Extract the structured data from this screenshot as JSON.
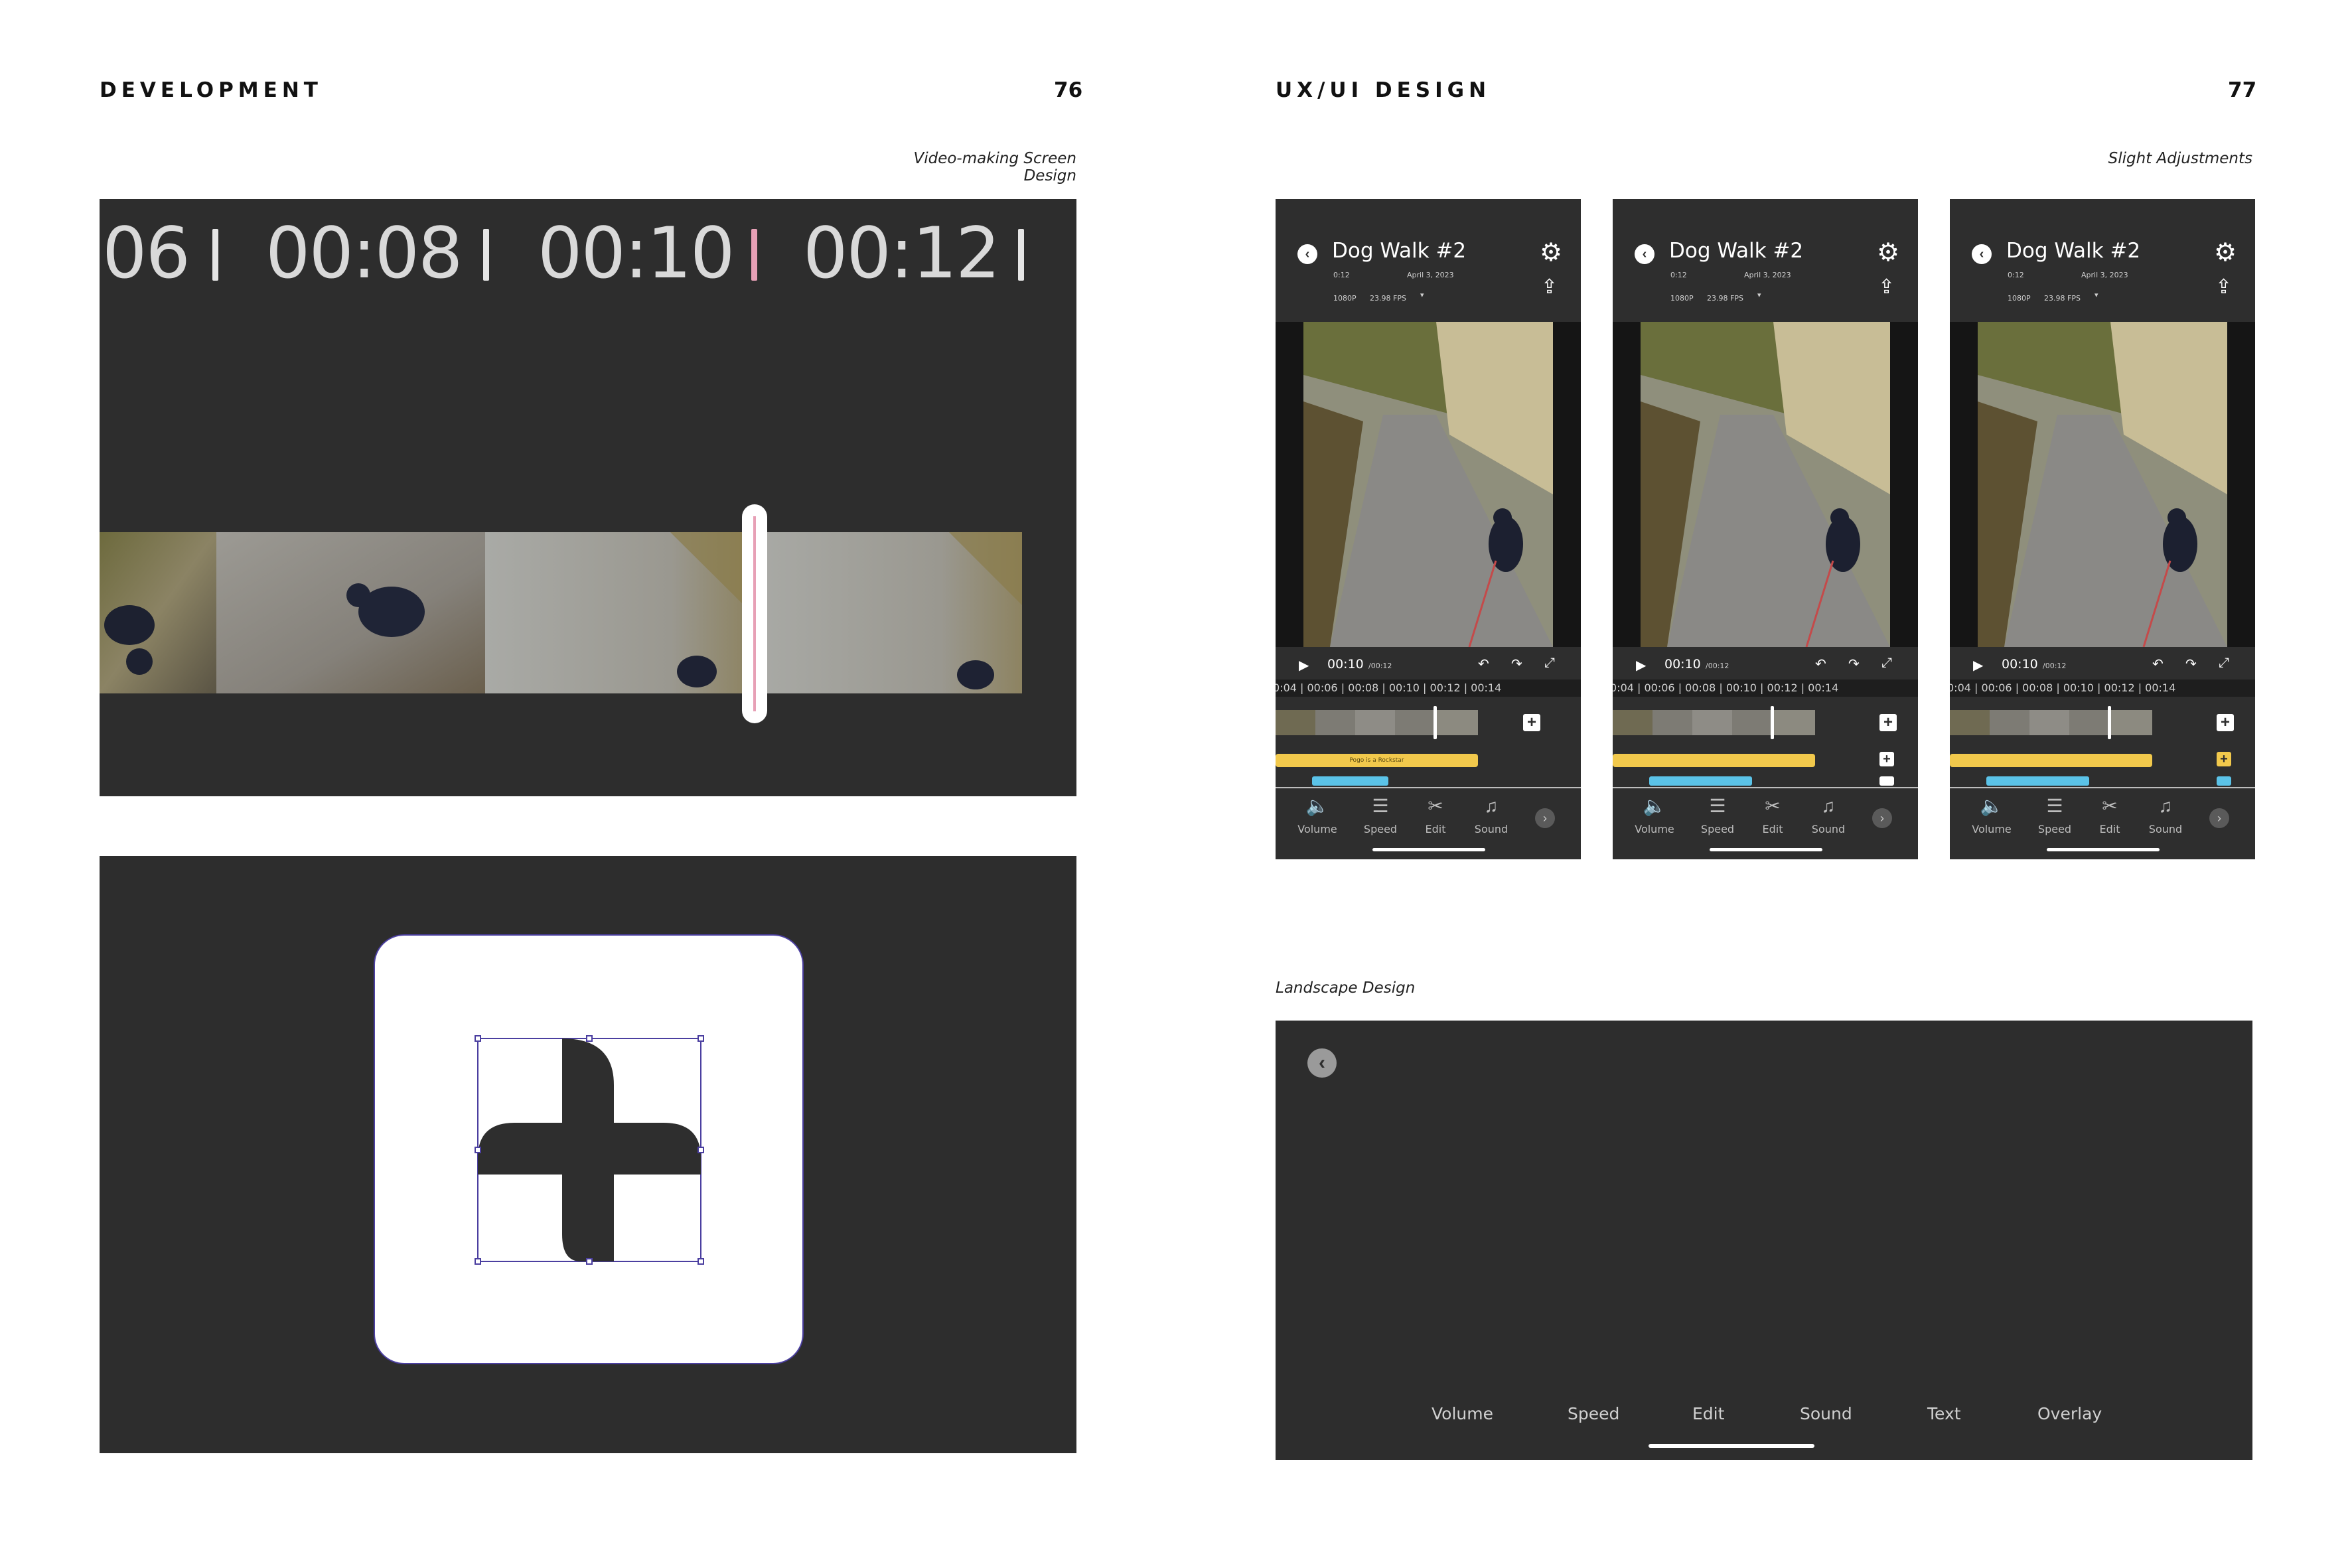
{
  "left_page": {
    "section_title": "DEVELOPMENT",
    "page_number": "76",
    "caption": "Video-making Screen Design",
    "timeline_labels": [
      "06",
      "00:08",
      "00:10",
      "00:12"
    ]
  },
  "right_page": {
    "section_title": "UX/UI DESIGN",
    "page_number": "77",
    "caption_top": "Slight Adjustments",
    "caption_bottom": "Landscape Design",
    "phone": {
      "title": "Dog Walk #2",
      "duration": "0:12",
      "date": "April 3, 2023",
      "quality": "1080P",
      "fps": "23.98 FPS",
      "current_time": "00:10",
      "total_time": "/00:12",
      "ruler": "0:04 | 00:06 | 00:08 | 00:10 | 00:12 | 00:14",
      "audio_track": "Pogo is a Rockstar",
      "tools": [
        "Volume",
        "Speed",
        "Edit",
        "Sound"
      ]
    },
    "landscape_tools": [
      "Volume",
      "Speed",
      "Edit",
      "Sound",
      "Text",
      "Overlay"
    ]
  },
  "colors": {
    "panel_dark": "#2d2d2d",
    "playhead_accent": "#e7a0b6",
    "audio_track": "#f2c94c",
    "text_track": "#5bc3e8",
    "selection_outline": "#4b3fa0"
  }
}
